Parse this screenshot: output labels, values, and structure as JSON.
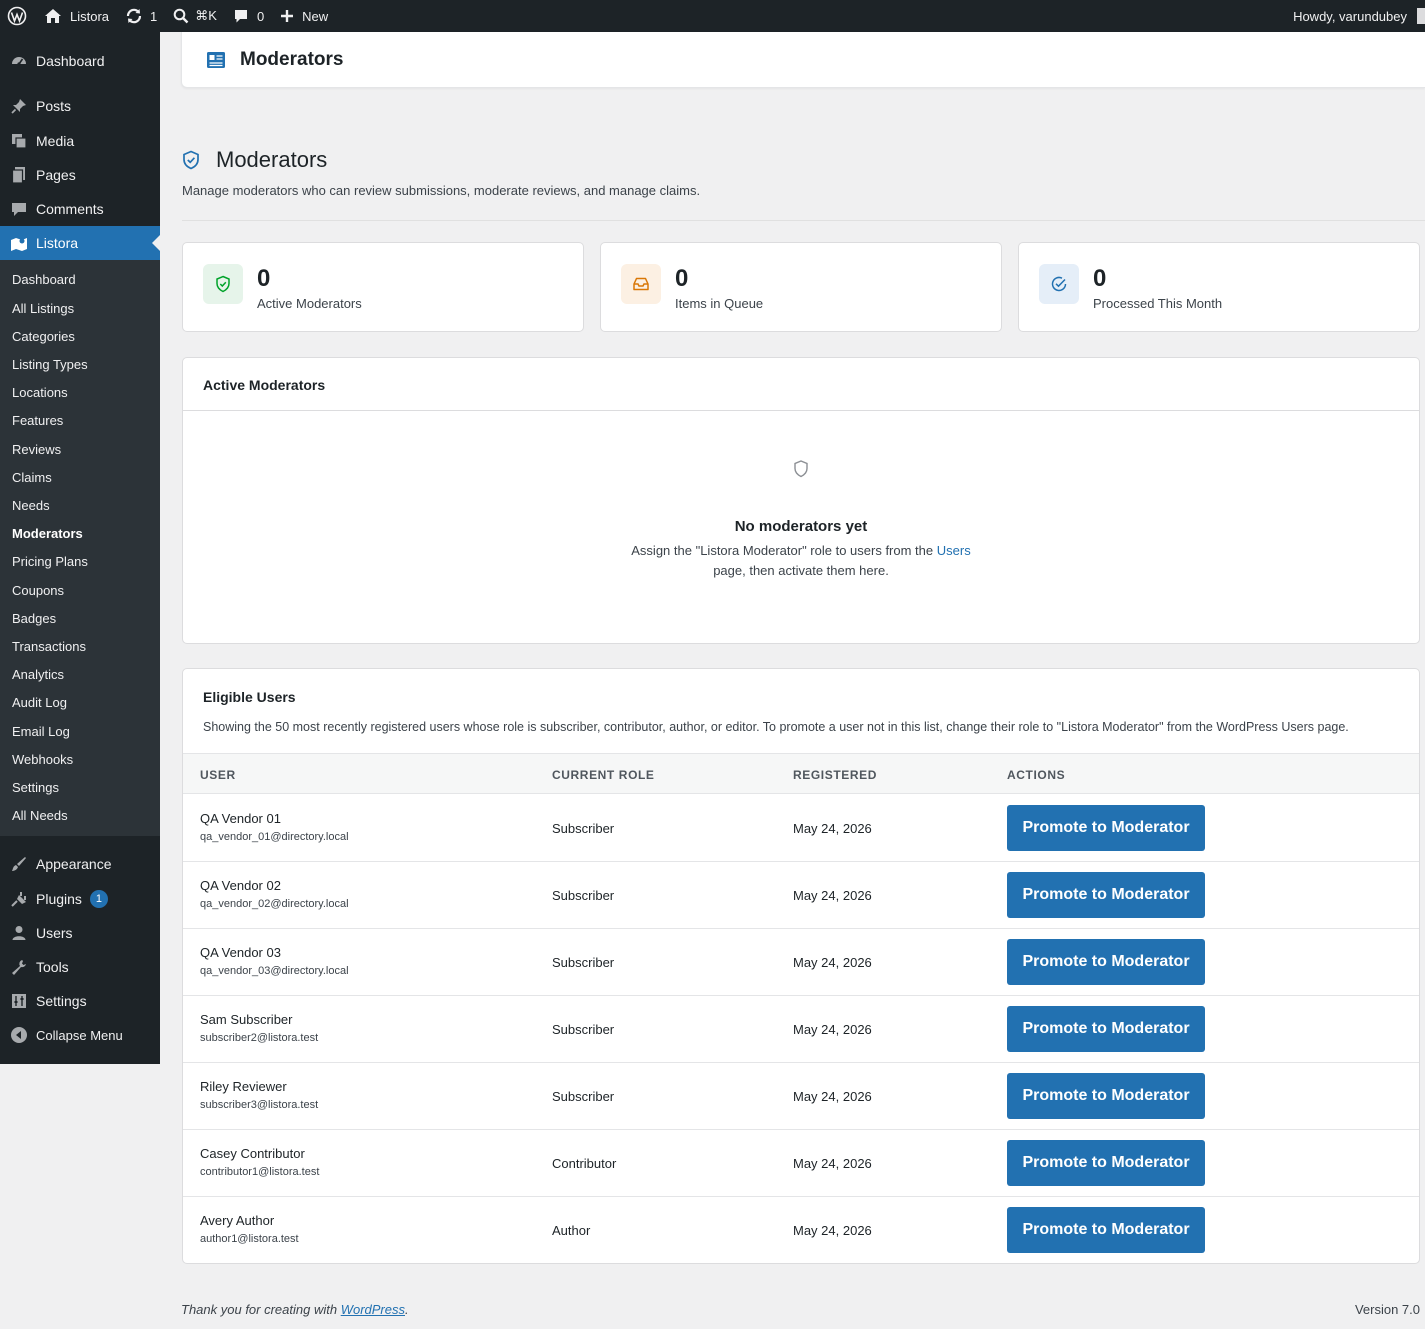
{
  "adminbar": {
    "site_name": "Listora",
    "updates_count": "1",
    "search_shortcut": "⌘K",
    "comments_count": "0",
    "new_label": "New",
    "greeting": "Howdy, varundubey"
  },
  "sidebar": {
    "top_items": [
      {
        "label": "Dashboard",
        "icon": "dashboard-icon"
      },
      {
        "label": "Posts",
        "icon": "pin-icon"
      },
      {
        "label": "Media",
        "icon": "media-icon"
      },
      {
        "label": "Pages",
        "icon": "pages-icon"
      },
      {
        "label": "Comments",
        "icon": "comment-icon"
      },
      {
        "label": "Listora",
        "icon": "map-icon"
      }
    ],
    "submenu": [
      "Dashboard",
      "All Listings",
      "Categories",
      "Listing Types",
      "Locations",
      "Features",
      "Reviews",
      "Claims",
      "Needs",
      "Moderators",
      "Pricing Plans",
      "Coupons",
      "Badges",
      "Transactions",
      "Analytics",
      "Audit Log",
      "Email Log",
      "Webhooks",
      "Settings",
      "All Needs"
    ],
    "bottom_items": [
      {
        "label": "Appearance",
        "icon": "brush-icon"
      },
      {
        "label": "Plugins",
        "icon": "plug-icon",
        "badge": "1"
      },
      {
        "label": "Users",
        "icon": "user-icon"
      },
      {
        "label": "Tools",
        "icon": "wrench-icon"
      },
      {
        "label": "Settings",
        "icon": "settings-icon"
      },
      {
        "label": "Collapse Menu",
        "icon": "collapse-icon"
      }
    ]
  },
  "header": {
    "title": "Moderators"
  },
  "page": {
    "title": "Moderators",
    "description": "Manage moderators who can review submissions, moderate reviews, and manage claims."
  },
  "stats": [
    {
      "value": "0",
      "label": "Active Moderators",
      "icon": "shield-check-icon",
      "color": "#00a32a",
      "bg": "#e6f4ea"
    },
    {
      "value": "0",
      "label": "Items in Queue",
      "icon": "inbox-icon",
      "color": "#dba617",
      "bg": "#fcf0e3"
    },
    {
      "value": "0",
      "label": "Processed This Month",
      "icon": "check-circle-icon",
      "color": "#2271b1",
      "bg": "#e5eef8"
    }
  ],
  "active_panel": {
    "title": "Active Moderators",
    "empty_title": "No moderators yet",
    "empty_text_1": "Assign the \"Listora Moderator\" role to users from the",
    "empty_link": "Users",
    "empty_text_2": "page, then activate them here."
  },
  "eligible_panel": {
    "title": "Eligible Users",
    "description": "Showing the 50 most recently registered users whose role is subscriber, contributor, author, or editor. To promote a user not in this list, change their role to \"Listora Moderator\" from the WordPress Users page.",
    "columns": [
      "USER",
      "CURRENT ROLE",
      "REGISTERED",
      "ACTIONS"
    ],
    "button_label": "Promote to Moderator",
    "rows": [
      {
        "name": "QA Vendor 01",
        "email": "qa_vendor_01@directory.local",
        "role": "Subscriber",
        "registered": "May 24, 2026"
      },
      {
        "name": "QA Vendor 02",
        "email": "qa_vendor_02@directory.local",
        "role": "Subscriber",
        "registered": "May 24, 2026"
      },
      {
        "name": "QA Vendor 03",
        "email": "qa_vendor_03@directory.local",
        "role": "Subscriber",
        "registered": "May 24, 2026"
      },
      {
        "name": "Sam Subscriber",
        "email": "subscriber2@listora.test",
        "role": "Subscriber",
        "registered": "May 24, 2026"
      },
      {
        "name": "Riley Reviewer",
        "email": "subscriber3@listora.test",
        "role": "Subscriber",
        "registered": "May 24, 2026"
      },
      {
        "name": "Casey Contributor",
        "email": "contributor1@listora.test",
        "role": "Contributor",
        "registered": "May 24, 2026"
      },
      {
        "name": "Avery Author",
        "email": "author1@listora.test",
        "role": "Author",
        "registered": "May 24, 2026"
      }
    ]
  },
  "footer": {
    "thanks_prefix": "Thank you for creating with",
    "thanks_link": "WordPress",
    "thanks_suffix": ".",
    "version": "Version 7.0"
  },
  "colors": {
    "accent": "#2271b1",
    "sidebar_bg": "#1d2327",
    "submenu_bg": "#2c3338"
  }
}
